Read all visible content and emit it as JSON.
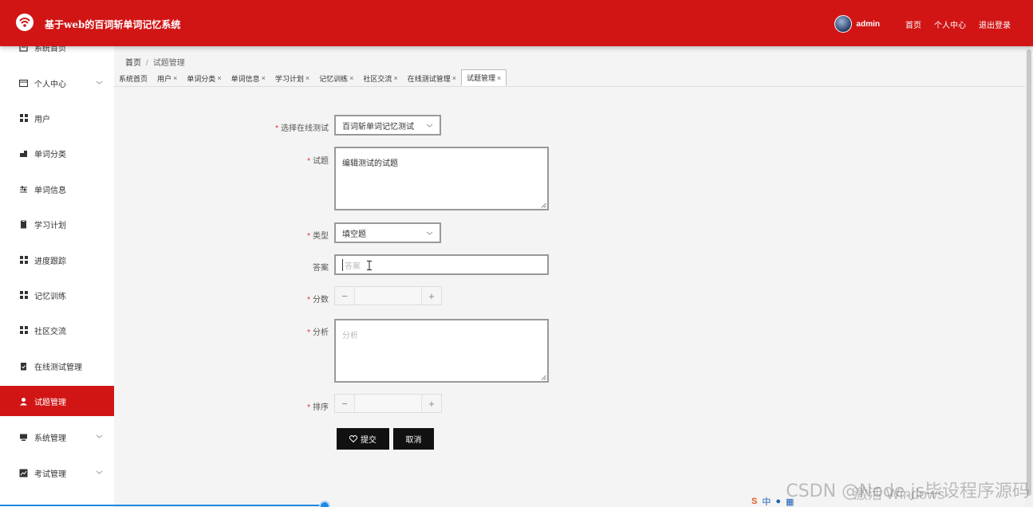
{
  "header": {
    "title": "基于web的百词斩单词记忆系统",
    "username": "admin",
    "links": [
      "首页",
      "个人中心",
      "退出登录"
    ]
  },
  "sidebar": {
    "items": [
      {
        "label": "系统首页",
        "icon": "document-icon"
      },
      {
        "label": "个人中心",
        "icon": "card-icon",
        "expandable": true
      },
      {
        "label": "用户",
        "icon": "grid-icon"
      },
      {
        "label": "单词分类",
        "icon": "category-icon"
      },
      {
        "label": "单词信息",
        "icon": "sliders-icon"
      },
      {
        "label": "学习计划",
        "icon": "clipboard-icon"
      },
      {
        "label": "进度跟踪",
        "icon": "grid-icon"
      },
      {
        "label": "记忆训练",
        "icon": "grid-icon"
      },
      {
        "label": "社区交流",
        "icon": "grid-icon"
      },
      {
        "label": "在线测试管理",
        "icon": "clipboard-check-icon"
      },
      {
        "label": "试题管理",
        "icon": "user-icon",
        "active": true
      },
      {
        "label": "系统管理",
        "icon": "monitor-icon",
        "expandable": true
      },
      {
        "label": "考试管理",
        "icon": "chart-icon",
        "expandable": true
      }
    ]
  },
  "breadcrumb": {
    "home": "首页",
    "separator": "/",
    "current": "试题管理"
  },
  "tabs": [
    {
      "label": "系统首页",
      "closable": false
    },
    {
      "label": "用户",
      "closable": true
    },
    {
      "label": "单词分类",
      "closable": true
    },
    {
      "label": "单词信息",
      "closable": true
    },
    {
      "label": "学习计划",
      "closable": true
    },
    {
      "label": "记忆训练",
      "closable": true
    },
    {
      "label": "社区交流",
      "closable": true
    },
    {
      "label": "在线测试管理",
      "closable": true
    },
    {
      "label": "试题管理",
      "closable": true,
      "active": true
    }
  ],
  "form": {
    "test_select": {
      "label": "选择在线测试",
      "value": "百词斩单词记忆测试"
    },
    "question": {
      "label": "试题",
      "value": "编辑测试的试题"
    },
    "type_select": {
      "label": "类型",
      "value": "填空题"
    },
    "answer": {
      "label": "答案",
      "placeholder": "答案"
    },
    "score": {
      "label": "分数"
    },
    "analysis": {
      "label": "分析",
      "placeholder": "分析"
    },
    "order": {
      "label": "排序"
    },
    "submit_label": "提交",
    "cancel_label": "取消"
  },
  "overlay": {
    "watermark": "CSDN @Node.js毕设程序源码",
    "activate_windows": "激活 Windows",
    "ime_text": "中"
  },
  "colors": {
    "primary": "#d11515",
    "button_dark": "#111111",
    "required": "#e03030"
  }
}
